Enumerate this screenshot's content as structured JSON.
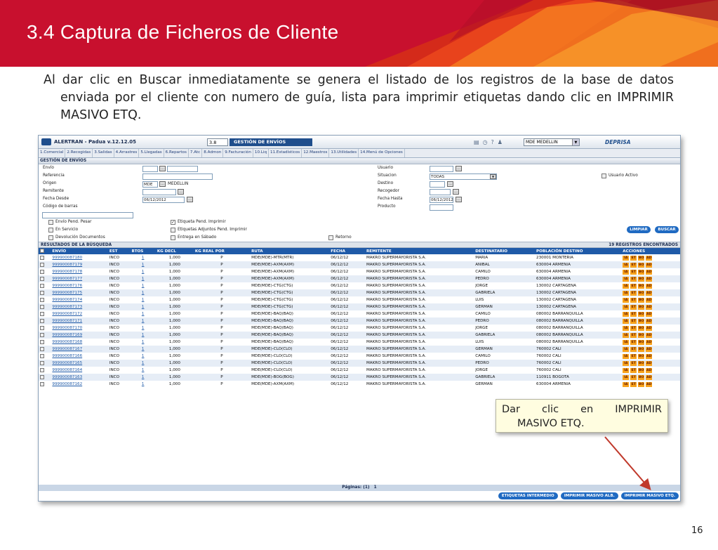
{
  "slide": {
    "title": "3.4 Captura de Ficheros de Cliente",
    "body_line1": "Al dar clic en Buscar inmediatamente se genera el listado de los registros de la base de datos enviada por el cliente con numero de guía, lista para imprimir etiquetas dando clic en IMPRIMIR MASIVO ETQ.",
    "page_number": "16",
    "callout_words": [
      "Dar",
      "clic",
      "en",
      "IMPRIMIR"
    ],
    "callout_line2": "MASIVO ETQ.",
    "colors": {
      "banner": "#c8102e",
      "accent_orange": "#f47b20",
      "app_blue": "#1f5aa8"
    }
  },
  "app": {
    "version": "ALERTRAN - Padua  v.12.12.05",
    "module_number": "3.8",
    "module_name": "GESTIÓN DE ENVÍOS",
    "office": "MDE MEDELLIN",
    "brand": "DEPRISA",
    "tabs": [
      "1.Comercial",
      "2.Recogidas",
      "3.Salidas",
      "4.Arrastres",
      "5.Llegadas",
      "6.Repartos",
      "7.Atc",
      "8.Admon",
      "9.Facturación",
      "10.Liq",
      "11.Estadísticos",
      "12.Maestros",
      "13.Utilidades",
      "14.Menú de Opciones"
    ],
    "section_title": "GESTIÓN DE ENVÍOS",
    "form": {
      "labels_left": [
        "Envío",
        "Referencia",
        "Origen",
        "Remitente",
        "Fecha Desde",
        "Código de barras"
      ],
      "origin_code": "MDE",
      "origin_name": "MEDELLIN",
      "fecha_desde": "06/12/2012",
      "labels_right": [
        "Usuario",
        "Situacion",
        "Destino",
        "Recogedor",
        "Fecha Hasta",
        "Producto"
      ],
      "situacion": "TODAS",
      "fecha_hasta": "06/12/2012",
      "usuario_activo": "Usuario Activo",
      "checks_col1": [
        "Envío Pend. Pesar",
        "En Servicio",
        "Devolución Documentos"
      ],
      "checks_col2": [
        "Etiqueta Pend. Imprimir",
        "Etiquetas Adjuntos Pend. Imprimir",
        "Entrega en Sábado"
      ],
      "retorno": "Retorno",
      "limpiar": "LIMPIAR",
      "buscar": "BUSCAR"
    },
    "results_title": "RESULTADOS DE LA BÚSQUEDA",
    "results_count": "19 REGISTROS ENCONTRADOS",
    "columns": [
      "ENVÍO",
      "EST",
      "BTOS",
      "KG DECL",
      "KG REAL POR",
      "RUTA",
      "FECHA",
      "REMITENTE",
      "DESTINATARIO",
      "POBLACIÓN DESTINO",
      "ACCIONES"
    ],
    "action_labels": [
      "IA",
      "ET",
      "BO",
      "AD"
    ],
    "rows": [
      [
        "999900087180",
        "INCO",
        "1",
        "1,000",
        "P",
        "MDE(MDE)-MTR(MTR)",
        "06/12/12",
        "MAKRO SUPERMAYORISTA S.A.",
        "MARIA",
        "230001 MONTERIA"
      ],
      [
        "999900087179",
        "INCO",
        "1",
        "1,000",
        "P",
        "MDE(MDE)-AXM(AXM)",
        "06/12/12",
        "MAKRO SUPERMAYORISTA S.A.",
        "ANIBAL",
        "630004 ARMENIA"
      ],
      [
        "999900087178",
        "INCO",
        "1",
        "1,000",
        "P",
        "MDE(MDE)-AXM(AXM)",
        "06/12/12",
        "MAKRO SUPERMAYORISTA S.A.",
        "CAMILO",
        "630004 ARMENIA"
      ],
      [
        "999900087177",
        "INCO",
        "1",
        "1,000",
        "P",
        "MDE(MDE)-AXM(AXM)",
        "06/12/12",
        "MAKRO SUPERMAYORISTA S.A.",
        "PEDRO",
        "630004 ARMENIA"
      ],
      [
        "999900087176",
        "INCO",
        "1",
        "1,000",
        "P",
        "MDE(MDE)-CTG(CTG)",
        "06/12/12",
        "MAKRO SUPERMAYORISTA S.A.",
        "JORGE",
        "130002 CARTAGENA"
      ],
      [
        "999900087175",
        "INCO",
        "1",
        "1,000",
        "P",
        "MDE(MDE)-CTG(CTG)",
        "06/12/12",
        "MAKRO SUPERMAYORISTA S.A.",
        "GABRIELA",
        "130002 CARTAGENA"
      ],
      [
        "999900087174",
        "INCO",
        "1",
        "1,000",
        "P",
        "MDE(MDE)-CTG(CTG)",
        "06/12/12",
        "MAKRO SUPERMAYORISTA S.A.",
        "LUIS",
        "130002 CARTAGENA"
      ],
      [
        "999900087173",
        "INCO",
        "1",
        "1,000",
        "P",
        "MDE(MDE)-CTG(CTG)",
        "06/12/12",
        "MAKRO SUPERMAYORISTA S.A.",
        "GERMAN",
        "130002 CARTAGENA"
      ],
      [
        "999900087172",
        "INCO",
        "1",
        "1,000",
        "P",
        "MDE(MDE)-BAQ(BAQ)",
        "06/12/12",
        "MAKRO SUPERMAYORISTA S.A.",
        "CAMILO",
        "080002 BARRANQUILLA"
      ],
      [
        "999900087171",
        "INCO",
        "1",
        "1,000",
        "P",
        "MDE(MDE)-BAQ(BAQ)",
        "06/12/12",
        "MAKRO SUPERMAYORISTA S.A.",
        "PEDRO",
        "080002 BARRANQUILLA"
      ],
      [
        "999900087170",
        "INCO",
        "1",
        "1,000",
        "P",
        "MDE(MDE)-BAQ(BAQ)",
        "06/12/12",
        "MAKRO SUPERMAYORISTA S.A.",
        "JORGE",
        "080002 BARRANQUILLA"
      ],
      [
        "999900087169",
        "INCO",
        "1",
        "1,000",
        "P",
        "MDE(MDE)-BAQ(BAQ)",
        "06/12/12",
        "MAKRO SUPERMAYORISTA S.A.",
        "GABRIELA",
        "080002 BARRANQUILLA"
      ],
      [
        "999900087168",
        "INCO",
        "1",
        "1,000",
        "P",
        "MDE(MDE)-BAQ(BAQ)",
        "06/12/12",
        "MAKRO SUPERMAYORISTA S.A.",
        "LUIS",
        "080002 BARRANQUILLA"
      ],
      [
        "999900087167",
        "INCO",
        "1",
        "1,000",
        "P",
        "MDE(MDE)-CLO(CLO)",
        "06/12/12",
        "MAKRO SUPERMAYORISTA S.A.",
        "GERMAN",
        "760002 CALI"
      ],
      [
        "999900087166",
        "INCO",
        "1",
        "1,000",
        "P",
        "MDE(MDE)-CLO(CLO)",
        "06/12/12",
        "MAKRO SUPERMAYORISTA S.A.",
        "CAMILO",
        "760002 CALI"
      ],
      [
        "999900087165",
        "INCO",
        "1",
        "1,000",
        "P",
        "MDE(MDE)-CLO(CLO)",
        "06/12/12",
        "MAKRO SUPERMAYORISTA S.A.",
        "PEDRO",
        "760002 CALI"
      ],
      [
        "999900087164",
        "INCO",
        "1",
        "1,000",
        "P",
        "MDE(MDE)-CLO(CLO)",
        "06/12/12",
        "MAKRO SUPERMAYORISTA S.A.",
        "JORGE",
        "760002 CALI"
      ],
      [
        "999900087163",
        "INCO",
        "1",
        "1,000",
        "P",
        "MDE(MDE)-BOG(BOG)",
        "06/12/12",
        "MAKRO SUPERMAYORISTA S.A.",
        "GABRIELA",
        "110911 BOGOTA"
      ],
      [
        "999900087162",
        "INCO",
        "1",
        "1,000",
        "P",
        "MDE(MDE)-AXM(AXM)",
        "06/12/12",
        "MAKRO SUPERMAYORISTA S.A.",
        "GERMAN",
        "630004 ARMENIA"
      ]
    ],
    "pages_label": "Páginas: (1)",
    "pages_current": "1",
    "bottom_buttons": [
      "ETIQUETAS INTERMEDIO",
      "IMPRIMIR MASIVO ALB.",
      "IMPRIMIR MASIVO ETQ."
    ]
  }
}
